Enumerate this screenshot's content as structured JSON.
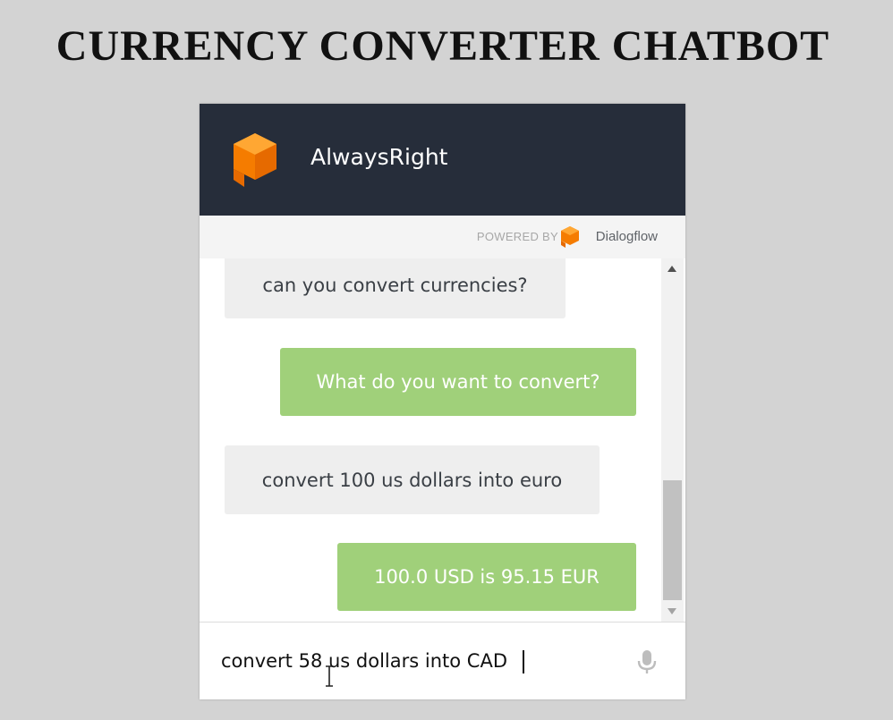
{
  "page": {
    "title": "CURRENCY CONVERTER CHATBOT"
  },
  "widget": {
    "bot_name": "AlwaysRight",
    "powered_by_label": "POWERED BY",
    "powered_by_brand": "Dialogflow",
    "colors": {
      "header_bg": "#262d3a",
      "logo_orange": "#f57c00",
      "bot_bubble": "#a0d07a",
      "user_bubble": "#eeeeee"
    }
  },
  "messages": [
    {
      "sender": "user",
      "text": "can you convert currencies?"
    },
    {
      "sender": "bot",
      "text": "What do you want to convert?"
    },
    {
      "sender": "user",
      "text": "convert 100 us dollars into euro"
    },
    {
      "sender": "bot",
      "text": "100.0 USD is 95.15 EUR"
    }
  ],
  "input": {
    "value": "convert 58 us dollars into CAD",
    "mic_icon": "microphone-icon"
  }
}
